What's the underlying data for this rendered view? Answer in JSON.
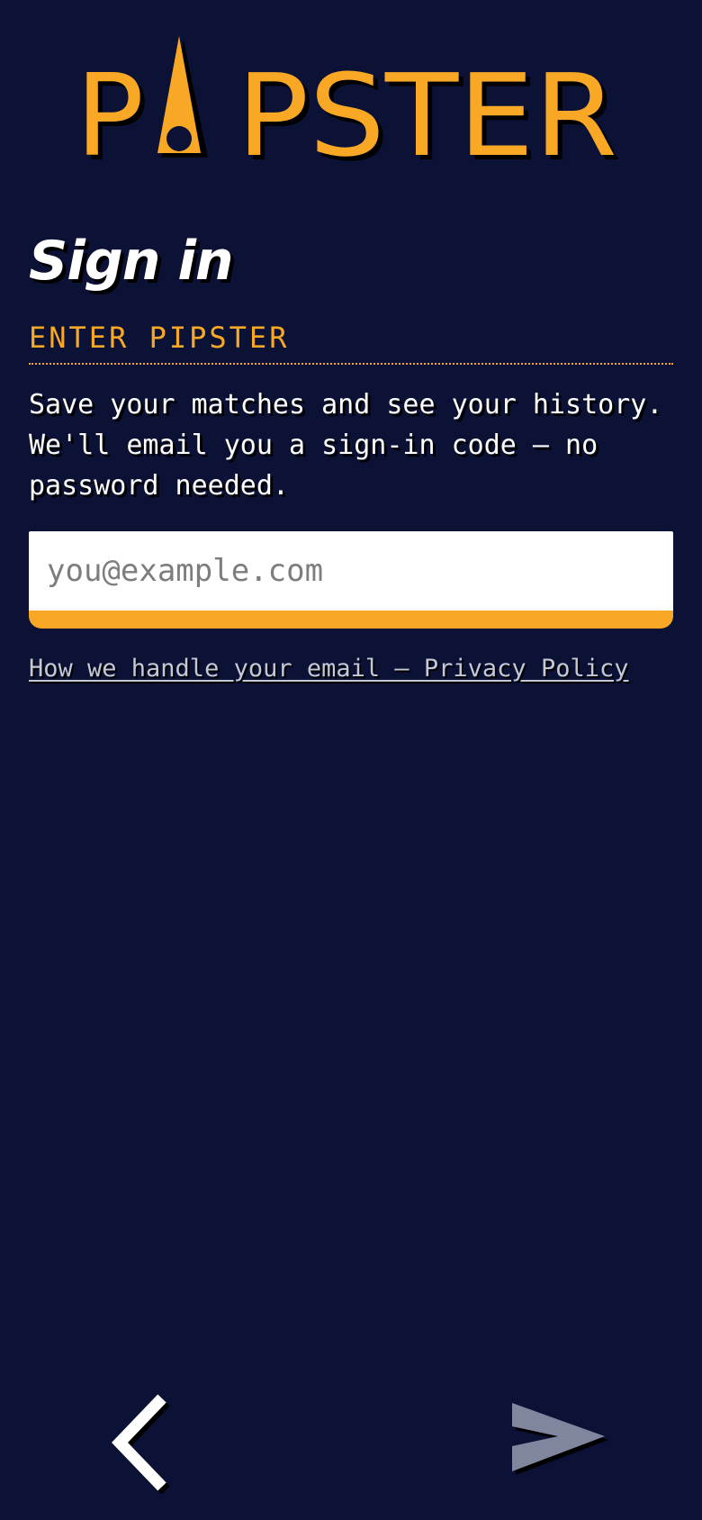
{
  "logo": {
    "text_before": "P",
    "text_after": "PSTER",
    "color": "#f9a826",
    "shadow_color": "#000000",
    "icon": "pin-needle-icon"
  },
  "page": {
    "title": "Sign in",
    "eyebrow": "ENTER PIPSTER",
    "description": "Save your matches and see your history. We'll email you a sign-in code — no password needed."
  },
  "email": {
    "placeholder": "you@example.com",
    "value": ""
  },
  "privacy": {
    "link_text": "How we handle your email — Privacy Policy"
  },
  "nav": {
    "back_icon": "chevron-left-icon",
    "next_icon": "send-arrow-icon",
    "next_enabled": false
  },
  "colors": {
    "background": "#0b1236",
    "accent": "#f9a826",
    "text": "#ffffff",
    "muted_link": "#c4c8d6",
    "disabled_icon": "#7f869d"
  }
}
